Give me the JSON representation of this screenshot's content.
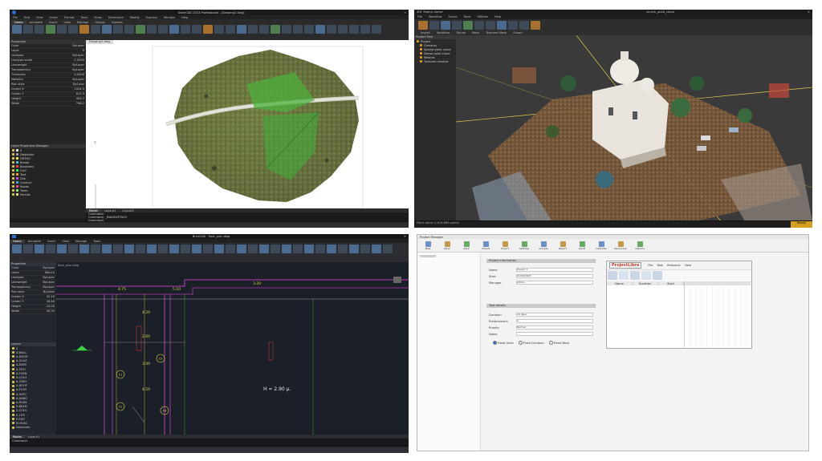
{
  "q1": {
    "app_title": "GstarCAD 2023 Professional - [Drawing1.dwg]",
    "menu": [
      "File",
      "Edit",
      "View",
      "Insert",
      "Format",
      "Tools",
      "Draw",
      "Dimension",
      "Modify",
      "Express",
      "Window",
      "Help"
    ],
    "tabs": [
      "Home",
      "Annotate",
      "Insert",
      "View",
      "Manage",
      "Output",
      "Express"
    ],
    "doc_tab": "Drawing1.dwg",
    "properties_title": "Properties",
    "prop_sections": [
      "General",
      "3D Visualization",
      "Plot style",
      "View"
    ],
    "prop_rows": [
      [
        "Color",
        "ByLayer"
      ],
      [
        "Layer",
        "0"
      ],
      [
        "Linetype",
        "ByLayer"
      ],
      [
        "Linetype scale",
        "1.0000"
      ],
      [
        "Lineweight",
        "ByLayer"
      ],
      [
        "Transparency",
        "ByLayer"
      ],
      [
        "Thickness",
        "0.0000"
      ],
      [
        "Material",
        "ByLayer"
      ],
      [
        "Plot style",
        "ByColor"
      ],
      [
        "Center X",
        "1024.5"
      ],
      [
        "Center Y",
        "812.3"
      ],
      [
        "Height",
        "455.7"
      ],
      [
        "Width",
        "798.2"
      ]
    ],
    "layers_title": "Layer Properties Manager",
    "layers": [
      "0",
      "Defpoints",
      "ORTHO",
      "Raster",
      "Boundary",
      "Grid",
      "Text",
      "Dim",
      "Contour",
      "Roads",
      "Trees",
      "Parcels"
    ],
    "model_tabs": [
      "Model",
      "Layout1",
      "Layout2"
    ],
    "command_lines": [
      "Command:",
      "Command: _IMAGEATTACH",
      "Command:"
    ]
  },
  "q2": {
    "app_title": "3DF Zephyr Aerial",
    "doc_title": "church_point_cloud",
    "menu": [
      "File",
      "Workflow",
      "Scene",
      "Tools",
      "Utilities",
      "Help"
    ],
    "ribbon_groups": [
      "Import",
      "Workflow",
      "Dense",
      "Mesh",
      "Textured Mesh",
      "Export"
    ],
    "project_title": "Project Tree",
    "tree": [
      "Project",
      "Cameras",
      "Sparse point cloud",
      "Dense point cloud",
      "Meshes",
      "Textured meshes"
    ],
    "status_left": "Point cloud: 2,814,665 points",
    "status_right": "Ready"
  },
  "q3": {
    "app_title": "BricsCAD - floor_plan.dwg",
    "menu": [
      "Home",
      "Annotate",
      "Insert",
      "View",
      "Manage",
      "Tools"
    ],
    "doc_tab": "floor_plan.dwg",
    "properties_title": "Properties",
    "prop_rows": [
      [
        "Color",
        "ByLayer"
      ],
      [
        "Layer",
        "WALLS"
      ],
      [
        "Linetype",
        "ByLayer"
      ],
      [
        "Lineweight",
        "ByLayer"
      ],
      [
        "Transparency",
        "ByLayer"
      ],
      [
        "Plot style",
        "ByColor"
      ],
      [
        "Center X",
        "52.10"
      ],
      [
        "Center Y",
        "18.44"
      ],
      [
        "Height",
        "12.00"
      ],
      [
        "Width",
        "20.55"
      ]
    ],
    "layers_title": "Layers",
    "layers": [
      "0",
      "A-WALL",
      "A-DOOR",
      "A-GLAZ",
      "A-DIMS",
      "A-TEXT",
      "A-FURN",
      "A-COLS",
      "A-GRID",
      "A-ROOF",
      "A-FLOR",
      "A-HATC",
      "A-ANNO",
      "A-PLAN",
      "S-BEAM",
      "S-COLS",
      "E-LITE",
      "P-FIXT",
      "M-HVAC",
      "Defpoints"
    ],
    "dims": [
      "4.75",
      "5.10",
      "3.20",
      "4.20",
      "2.60",
      "3.00",
      "4.50"
    ],
    "level_text": "H = 2.90 μ.",
    "bubbles": [
      "Σ1",
      "Σ2",
      "Σ3",
      "Σ4"
    ],
    "model_tabs": [
      "Model",
      "Layout1"
    ],
    "command_text": "Command:"
  },
  "q4": {
    "app_title": "Project Manager",
    "toolbar": [
      "New",
      "Open",
      "Save",
      "Import",
      "Export",
      "Settings",
      "Analyze",
      "Report",
      "Gantt",
      "Calendar",
      "Resources",
      "Options"
    ],
    "section1_title": "Project information",
    "section1_fields": [
      [
        "Name",
        "Project 1"
      ],
      [
        "Start",
        "01/02/2023"
      ],
      [
        "Manager",
        "Admin"
      ]
    ],
    "section2_title": "Task details",
    "section2_fields": [
      [
        "Duration",
        "10 days"
      ],
      [
        "Predecessors",
        "1"
      ],
      [
        "Priority",
        "Normal"
      ],
      [
        "Notes",
        ""
      ]
    ],
    "radio_labels": [
      "Fixed Units",
      "Fixed Duration",
      "Fixed Work"
    ],
    "embedded_title": "ProjectLibre",
    "embedded_tabs": [
      "File",
      "Task",
      "Resource",
      "View"
    ],
    "grid_headers": [
      "Name",
      "Duration",
      "Start"
    ]
  }
}
